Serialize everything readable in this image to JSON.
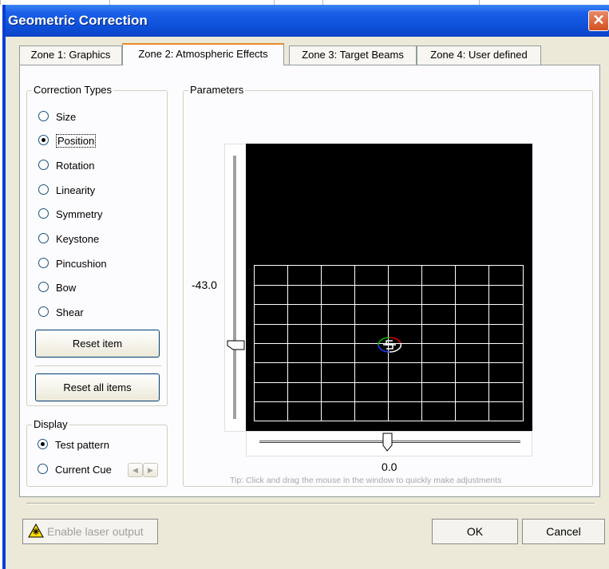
{
  "window": {
    "title": "Geometric Correction",
    "close": "✕"
  },
  "tabs": [
    {
      "label": "Zone 1: Graphics"
    },
    {
      "label": "Zone 2: Atmospheric Effects"
    },
    {
      "label": "Zone 3: Target Beams"
    },
    {
      "label": "Zone 4: User defined"
    }
  ],
  "correction_types": {
    "label": "Correction Types",
    "items": [
      "Size",
      "Position",
      "Rotation",
      "Linearity",
      "Symmetry",
      "Keystone",
      "Pincushion",
      "Bow",
      "Shear"
    ],
    "selected": "Position",
    "reset_item": "Reset item",
    "reset_all": "Reset all items"
  },
  "display": {
    "label": "Display",
    "test_pattern": "Test pattern",
    "current_cue": "Current Cue",
    "selected": "Test pattern"
  },
  "parameters": {
    "label": "Parameters",
    "vertical_value": "-43.0",
    "horizontal_value": "0.0",
    "tip": "Tip: Click and drag the mouse in the window to quickly make adjustments"
  },
  "footer": {
    "enable_laser": "Enable laser output",
    "ok": "OK",
    "cancel": "Cancel"
  },
  "colors": {
    "title_blue": "#0d4fd8",
    "tab_highlight": "#e68b2c",
    "canvas": "#000000",
    "grid": "#ffffff"
  }
}
